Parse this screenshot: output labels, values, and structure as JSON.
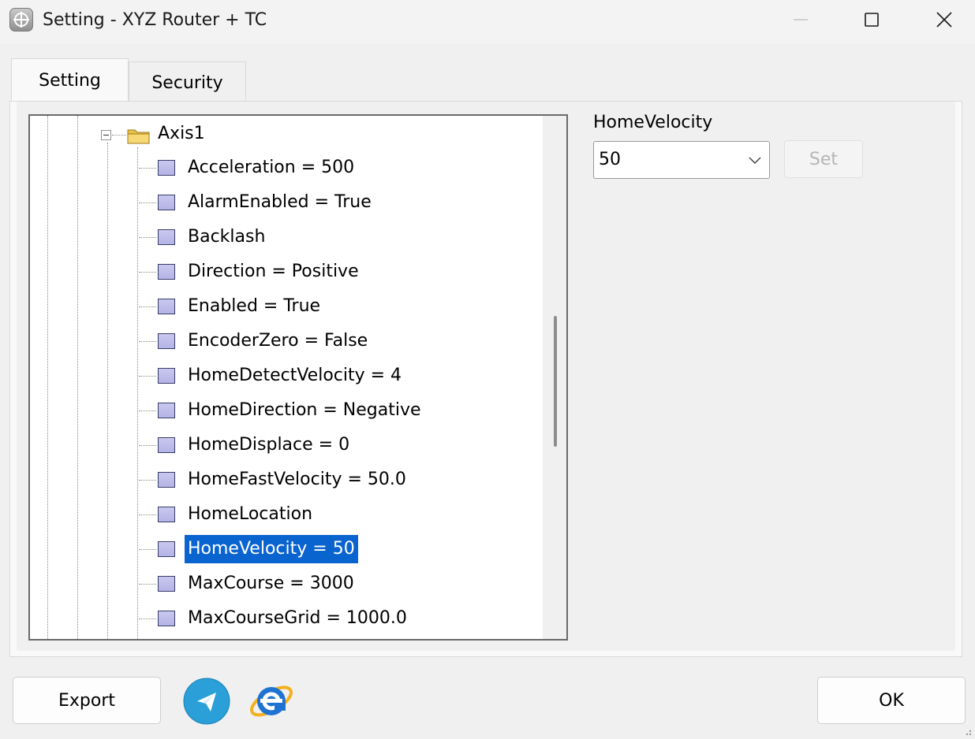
{
  "window": {
    "title": "Setting - XYZ Router + TC",
    "icon": "crosshair-app-icon"
  },
  "tabs": [
    {
      "label": "Setting",
      "active": true
    },
    {
      "label": "Security",
      "active": false
    }
  ],
  "tree": {
    "parent_label": "Axis1",
    "items": [
      {
        "label": "Acceleration = 500",
        "selected": false
      },
      {
        "label": "AlarmEnabled = True",
        "selected": false
      },
      {
        "label": "Backlash",
        "selected": false
      },
      {
        "label": "Direction = Positive",
        "selected": false
      },
      {
        "label": "Enabled = True",
        "selected": false
      },
      {
        "label": "EncoderZero = False",
        "selected": false
      },
      {
        "label": "HomeDetectVelocity = 4",
        "selected": false
      },
      {
        "label": "HomeDirection = Negative",
        "selected": false
      },
      {
        "label": "HomeDisplace = 0",
        "selected": false
      },
      {
        "label": "HomeFastVelocity = 50.0",
        "selected": false
      },
      {
        "label": "HomeLocation",
        "selected": false
      },
      {
        "label": "HomeVelocity = 50",
        "selected": true
      },
      {
        "label": "MaxCourse = 3000",
        "selected": false
      },
      {
        "label": "MaxCourseGrid = 1000.0",
        "selected": false
      }
    ]
  },
  "property": {
    "label": "HomeVelocity",
    "value": "50",
    "set_label": "Set"
  },
  "footer": {
    "export_label": "Export",
    "ok_label": "OK"
  },
  "colors": {
    "selection": "#0a64d0",
    "telegram": "#2a9fd8",
    "ie_blue": "#1e73d2"
  }
}
